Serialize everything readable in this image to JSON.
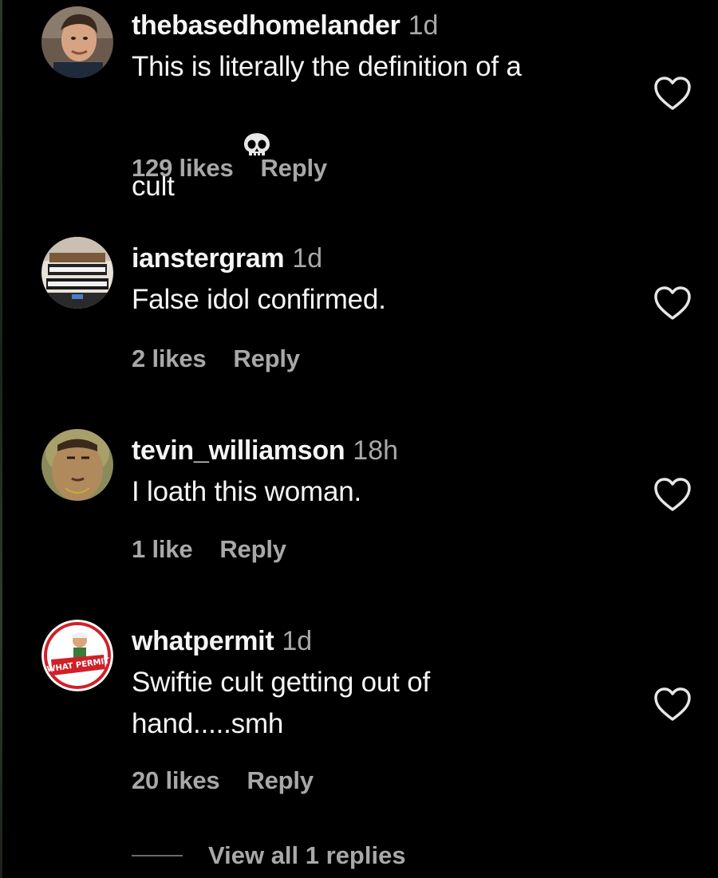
{
  "comments": [
    {
      "username": "thebasedhomelander",
      "time": "1d",
      "text": "This is literally the definition of a\ncult",
      "emoji": "skull-emoji",
      "likes": "129 likes",
      "reply": "Reply"
    },
    {
      "username": "ianstergram",
      "time": "1d",
      "text": "False idol confirmed.",
      "likes": "2 likes",
      "reply": "Reply"
    },
    {
      "username": "tevin_williamson",
      "time": "18h",
      "text": "I loath this woman.",
      "likes": "1 like",
      "reply": "Reply"
    },
    {
      "username": "whatpermit",
      "time": "1d",
      "text": "Swiftie cult getting out of\nhand.....smh",
      "likes": "20 likes",
      "reply": "Reply"
    }
  ],
  "view_replies": "View all 1 replies",
  "avatar_logo_text": "WHAT PERMIT",
  "colors": {
    "background": "#000000",
    "primary_text": "#f5f5f5",
    "secondary_text": "#a8a8a8",
    "logo_red": "#d0202a"
  },
  "icons": [
    "heart-icon",
    "skull-emoji"
  ]
}
